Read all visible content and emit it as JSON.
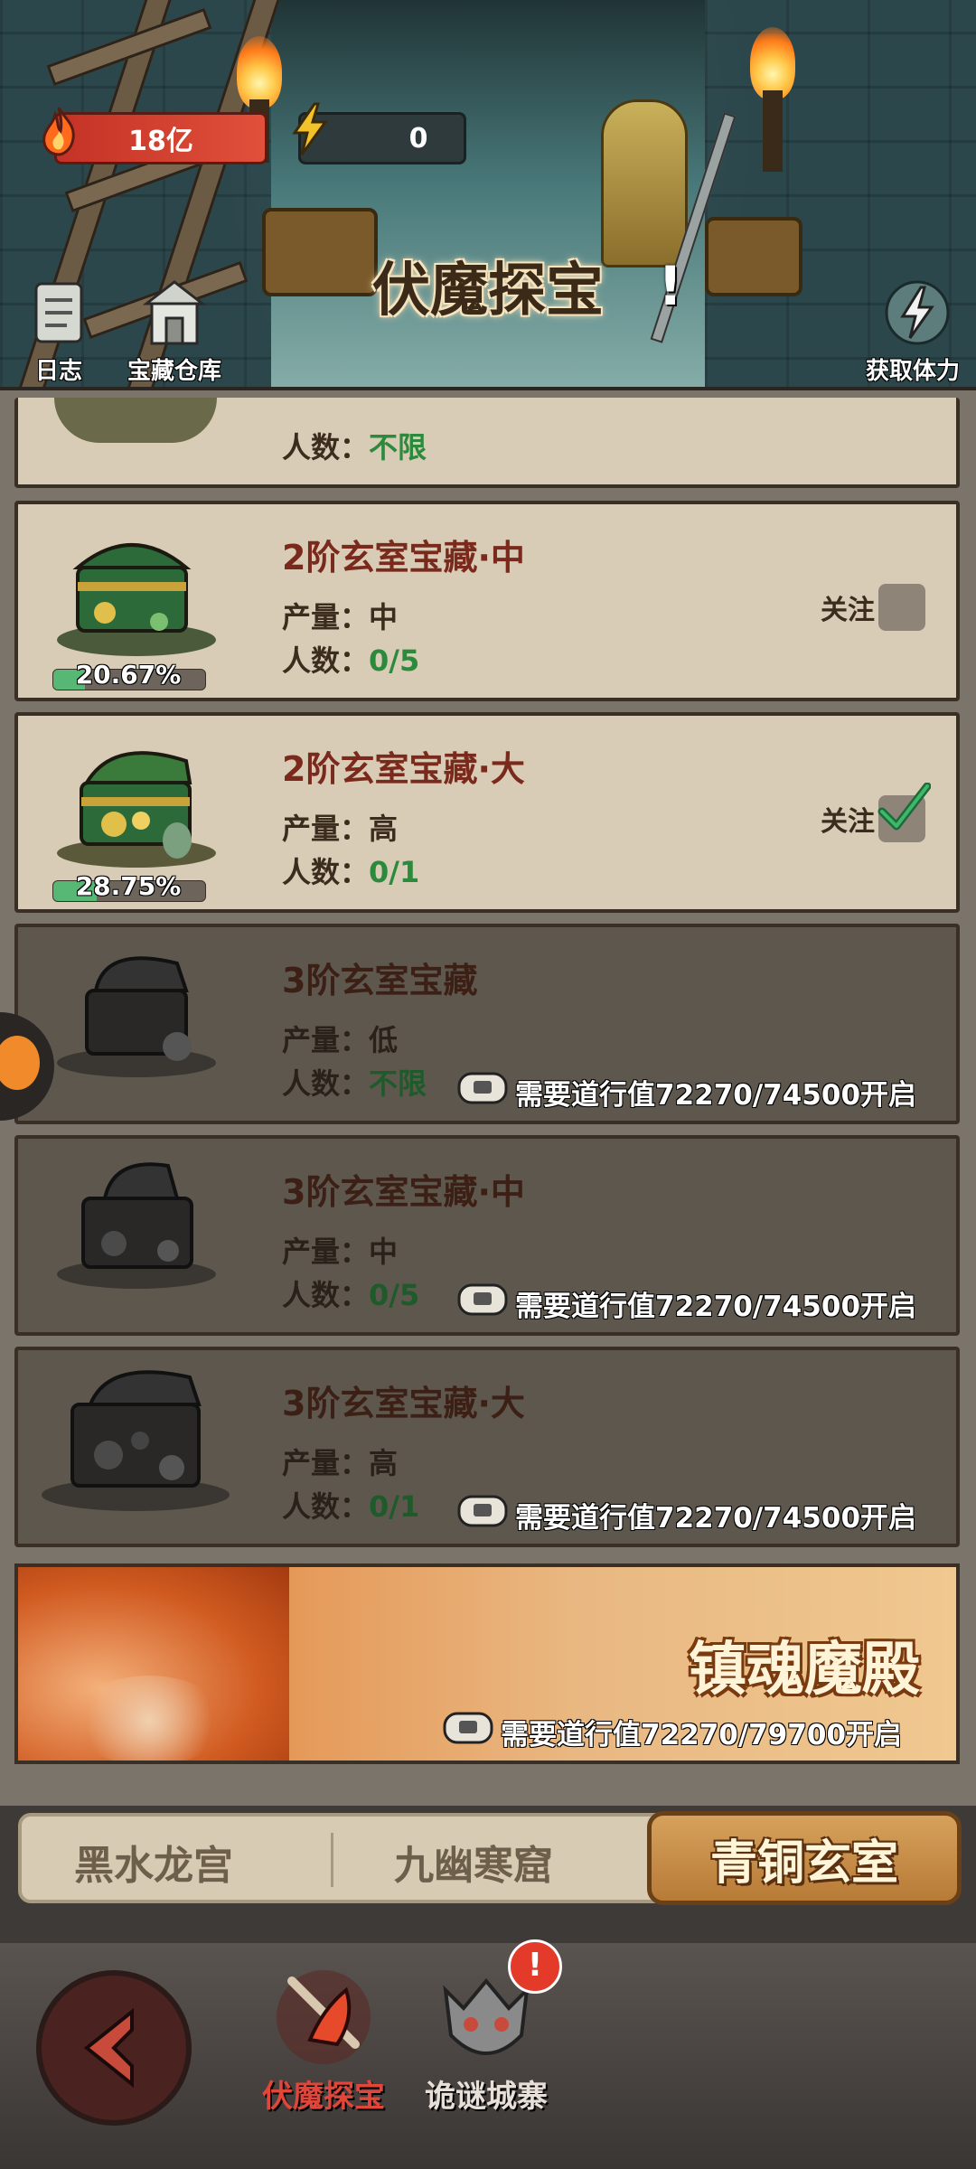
{
  "header": {
    "title": "伏魔探宝",
    "stats": {
      "fire_value": "18亿",
      "energy_value": "0"
    },
    "buttons": {
      "log": "日志",
      "warehouse": "宝藏仓库",
      "stamina": "获取体力"
    }
  },
  "partial_row": {
    "count_label": "人数：",
    "count_value": "不限"
  },
  "cards": [
    {
      "name": "2阶玄室宝藏·中",
      "output_label": "产量：",
      "output_value": "中",
      "count_label": "人数：",
      "count_value": "0/5",
      "follow_label": "关注",
      "followed": false,
      "progress_text": "20.67%",
      "progress": 0.2067
    },
    {
      "name": "2阶玄室宝藏·大",
      "output_label": "产量：",
      "output_value": "高",
      "count_label": "人数：",
      "count_value": "0/1",
      "follow_label": "关注",
      "followed": true,
      "progress_text": "28.75%",
      "progress": 0.2875
    },
    {
      "name": "3阶玄室宝藏",
      "output_label": "产量：",
      "output_value": "低",
      "count_label": "人数：",
      "count_value": "不限",
      "lock_text": "需要道行值72270/74500开启"
    },
    {
      "name": "3阶玄室宝藏·中",
      "output_label": "产量：",
      "output_value": "中",
      "count_label": "人数：",
      "count_value": "0/5",
      "lock_text": "需要道行值72270/74500开启"
    },
    {
      "name": "3阶玄室宝藏·大",
      "output_label": "产量：",
      "output_value": "高",
      "count_label": "人数：",
      "count_value": "0/1",
      "lock_text": "需要道行值72270/74500开启"
    }
  ],
  "lava": {
    "title": "镇魂魔殿",
    "lock_text": "需要道行值72270/79700开启"
  },
  "tabs": {
    "tab1": "黑水龙宫",
    "tab2": "九幽寒窟",
    "tab3": "青铜玄室"
  },
  "nav": {
    "item1": "伏魔探宝",
    "item2": "诡谜城寨"
  },
  "colors": {
    "accent_red": "#c43226",
    "value_green": "#2b8a3c",
    "active_nav": "#e0463a"
  }
}
